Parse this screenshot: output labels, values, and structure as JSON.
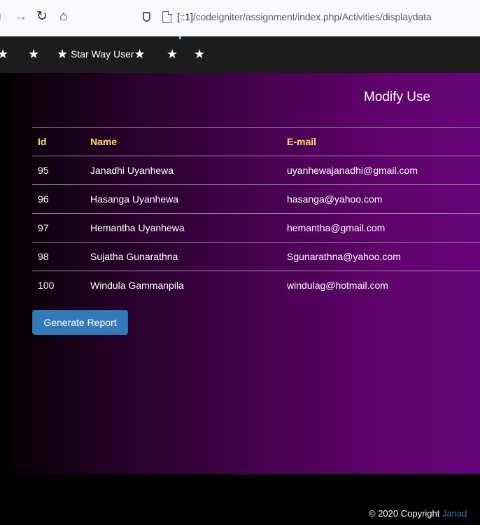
{
  "browser": {
    "url_host": "[::1]",
    "url_path": "/codeigniter/assignment/index.php/Activities/displaydata"
  },
  "navbar": {
    "brand_label": "Star Way User",
    "star_glyph": "★"
  },
  "page": {
    "title": "Modify Use"
  },
  "table": {
    "headers": [
      "Id",
      "Name",
      "E-mail"
    ],
    "rows": [
      {
        "id": "95",
        "name": "Janadhi Uyanhewa",
        "email": "uyanhewajanadhi@gmail.com"
      },
      {
        "id": "96",
        "name": "Hasanga Uyanhewa",
        "email": "hasanga@yahoo.com"
      },
      {
        "id": "97",
        "name": "Hemantha Uyanhewa",
        "email": "hemantha@gmail.com"
      },
      {
        "id": "98",
        "name": "Sujatha Gunarathna",
        "email": "Sgunarathna@yahoo.com"
      },
      {
        "id": "100",
        "name": "Windula Gammanpila",
        "email": "windulag@hotmail.com"
      }
    ]
  },
  "actions": {
    "generate_report_label": "Generate Report"
  },
  "footer": {
    "copyright_text": "© 2020 Copyright",
    "copyright_link": "Janad"
  },
  "colors": {
    "header_text": "#ffe066",
    "button": "#337ab7",
    "gradient_end": "#67037a"
  }
}
